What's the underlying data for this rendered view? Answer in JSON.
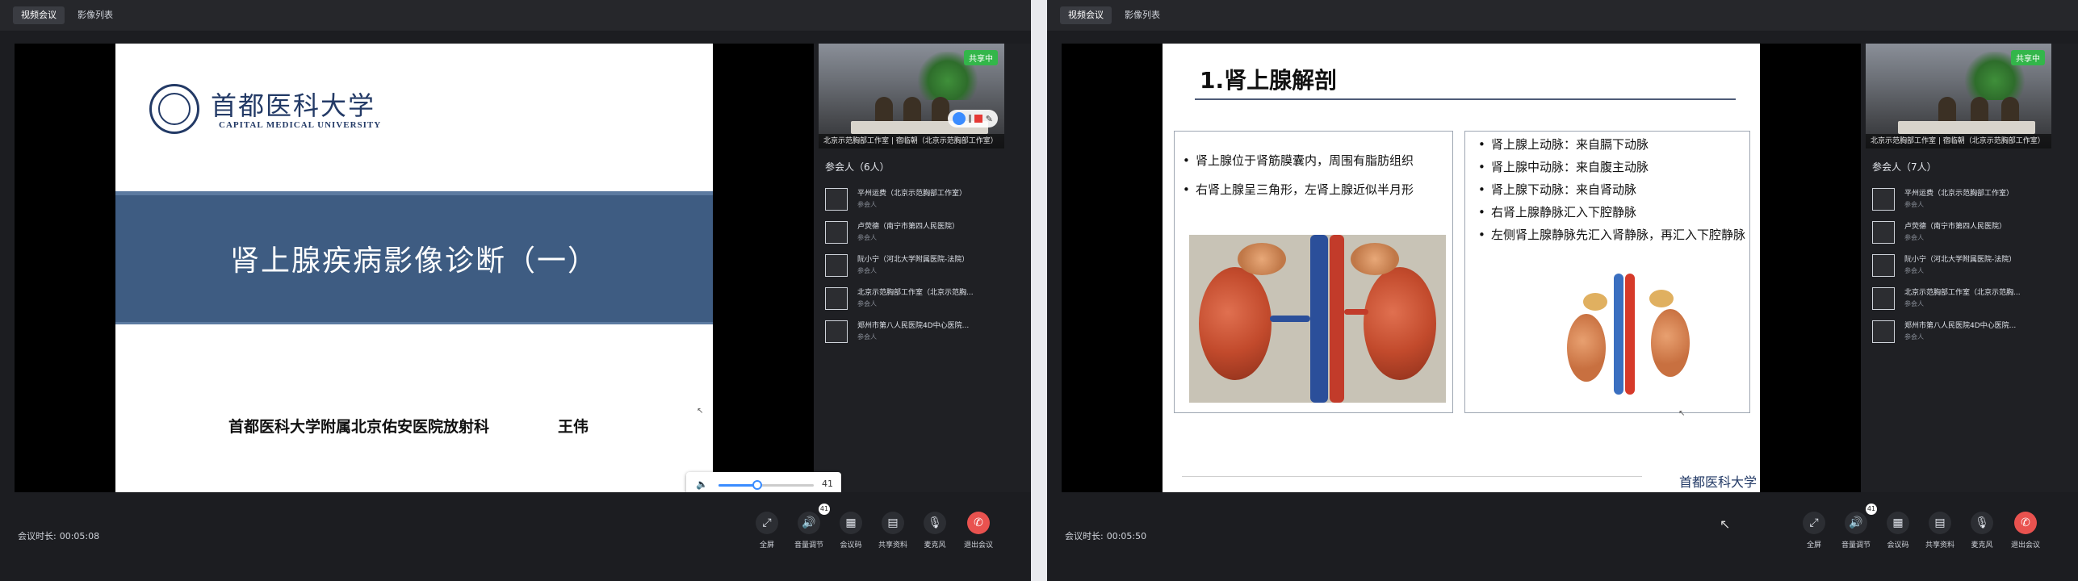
{
  "tabs": {
    "meeting": "视频会议",
    "images": "影像列表"
  },
  "window1": {
    "slide": {
      "logo_cn": "首都医科大学",
      "logo_en": "CAPITAL MEDICAL UNIVERSITY",
      "title": "肾上腺疾病影像诊断（一）",
      "institution": "首都医科大学附属北京佑安医院放射科",
      "author": "王伟"
    },
    "volume": {
      "value": "41",
      "level": 0.41
    },
    "thumbnail": {
      "badge": "共享中",
      "caption": "北京示范胸部工作室 | 宿临朝（北京示范胸部工作室）"
    },
    "participants_title": "参会人（6人）",
    "participants": [
      {
        "name": "平州运费（北京示范胸部工作室）",
        "role": "参会人"
      },
      {
        "name": "卢荧德（南宁市第四人民医院）",
        "role": "参会人"
      },
      {
        "name": "阮小宁（河北大学附属医院-法院）",
        "role": "参会人"
      },
      {
        "name": "北京示范胸部工作室（北京示范胸...",
        "role": "参会人"
      },
      {
        "name": "郑州市第八人民医院4D中心医院...",
        "role": "参会人"
      }
    ],
    "duration_label": "会议时长:",
    "duration": "00:05:08",
    "mic_badge": "41"
  },
  "window2": {
    "slide": {
      "heading": "1.肾上腺解剖",
      "left_bullets": [
        "肾上腺位于肾筋膜囊内，周围有脂肪组织",
        "右肾上腺呈三角形，左肾上腺近似半月形"
      ],
      "right_bullets": [
        "肾上腺上动脉：来自膈下动脉",
        "肾上腺中动脉：来自腹主动脉",
        "肾上腺下动脉：来自肾动脉",
        "右肾上腺静脉汇入下腔静脉",
        "左侧肾上腺静脉先汇入肾静脉，再汇入下腔静脉"
      ],
      "footer_logo": "首都医科大学"
    },
    "thumbnail": {
      "badge": "共享中",
      "caption": "北京示范胸部工作室 | 宿临朝（北京示范胸部工作室）"
    },
    "participants_title": "参会人（7人）",
    "participants": [
      {
        "name": "平州运费（北京示范胸部工作室）",
        "role": "参会人"
      },
      {
        "name": "卢荧德（南宁市第四人民医院）",
        "role": "参会人"
      },
      {
        "name": "阮小宁（河北大学附属医院-法院）",
        "role": "参会人"
      },
      {
        "name": "北京示范胸部工作室（北京示范胸...",
        "role": "参会人"
      },
      {
        "name": "郑州市第八人民医院4D中心医院...",
        "role": "参会人"
      }
    ],
    "duration_label": "会议时长:",
    "duration": "00:05:50",
    "mic_badge": "41"
  },
  "controls": {
    "fullscreen": "全屏",
    "audio": "音量调节",
    "meeting_info": "会议码",
    "share_doc": "共享资料",
    "mic": "麦克风",
    "leave": "退出会议"
  },
  "icons": {
    "fullscreen": "fullscreen-icon",
    "audio": "speaker-icon",
    "meeting_info": "qr-code-icon",
    "share_doc": "document-icon",
    "mic": "microphone-icon",
    "leave": "hang-up-icon"
  },
  "colors": {
    "leave_red": "#e9524f",
    "share_green": "#33b64a",
    "slide_band": "#3e5c82",
    "accent_blue": "#3a8cff"
  }
}
